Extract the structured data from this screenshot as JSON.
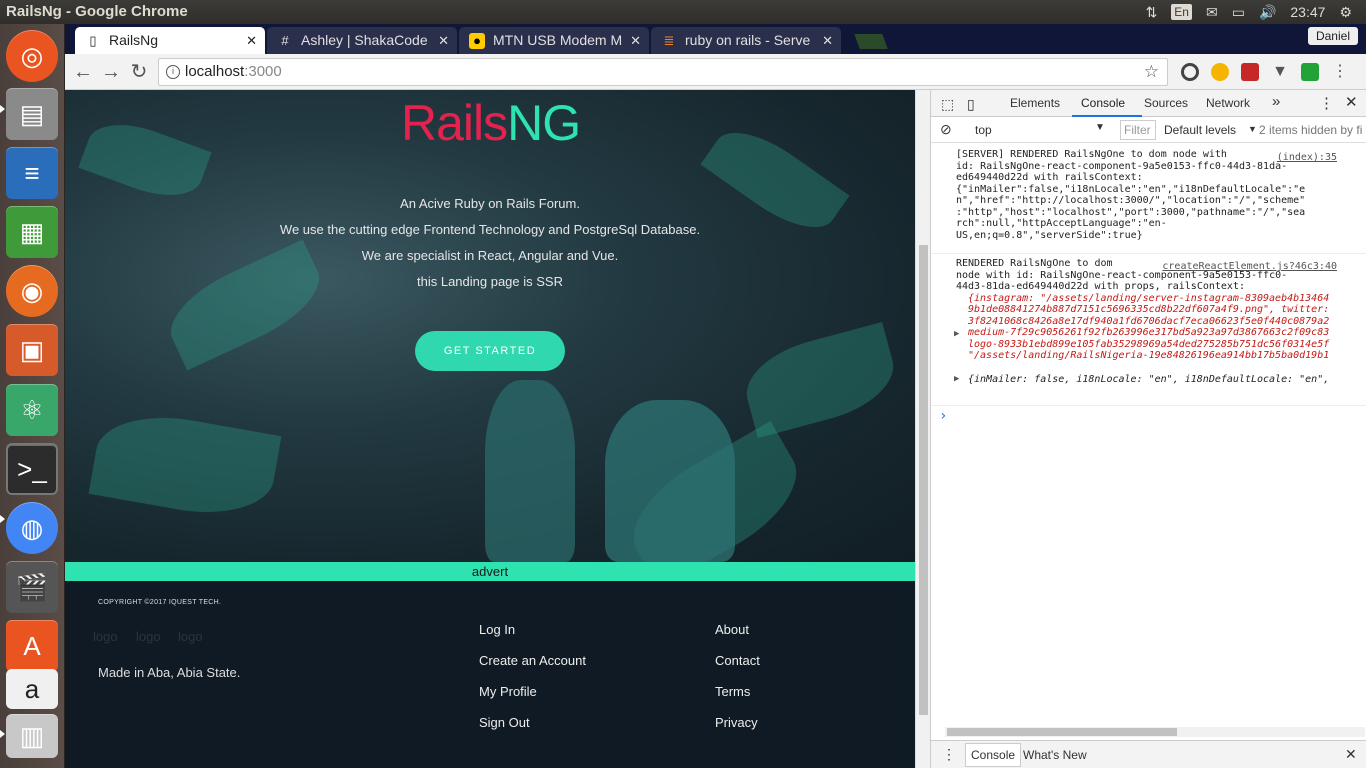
{
  "os": {
    "window_title": "RailsNg - Google Chrome",
    "keyboard_lang": "En",
    "clock": "23:47",
    "tray_icons": [
      "network-icon",
      "mail-icon",
      "battery-icon",
      "volume-icon",
      "power-icon"
    ]
  },
  "launcher": {
    "items": [
      "ubuntu-dash-icon",
      "files-icon",
      "writer-icon",
      "calc-icon",
      "firefox-icon",
      "impress-icon",
      "atom-icon",
      "terminal-icon",
      "chrome-icon",
      "video-icon",
      "software-center-icon",
      "amazon-icon",
      "trash-icon"
    ]
  },
  "browser": {
    "tabs": [
      {
        "label": "RailsNg",
        "icon": "page-icon",
        "active": true
      },
      {
        "label": "Ashley | ShakaCode",
        "icon": "hash-icon",
        "active": false
      },
      {
        "label": "MTN USB Modem M",
        "icon": "mtn-icon",
        "active": false
      },
      {
        "label": "ruby on rails - Serve",
        "icon": "stackoverflow-icon",
        "active": false
      }
    ],
    "profile_name": "Daniel",
    "url_host": "localhost",
    "url_port": ":3000"
  },
  "page": {
    "logo_red": "Rails",
    "logo_green": "NG",
    "taglines": [
      "An Acive Ruby on Rails Forum.",
      "We use the cutting edge Frontend Technology and PostgreSql Database.",
      "We are specialist in React, Angular and Vue.",
      "this Landing page is SSR"
    ],
    "cta_label": "GET STARTED",
    "advert_label": "advert",
    "footer": {
      "copyright": "COPYRIGHT ©2017 IQUEST TECH.",
      "logo_placeholders": [
        "logo",
        "logo",
        "logo"
      ],
      "made_in": "Made in Aba, Abia State.",
      "links_col1": [
        "Log In",
        "Create an Account",
        "My Profile",
        "Sign Out"
      ],
      "links_col2": [
        "About",
        "Contact",
        "Terms",
        "Privacy"
      ]
    }
  },
  "devtools": {
    "tabs": [
      "Elements",
      "Console",
      "Sources",
      "Network"
    ],
    "active_tab": "Console",
    "more_tabs": "»",
    "context": "top",
    "filter_placeholder": "Filter",
    "levels": "Default levels",
    "hidden_note": "2 items hidden by fi",
    "messages": [
      {
        "source": "(index):35",
        "lines": [
          "[SERVER] RENDERED RailsNgOne to dom node with",
          "id: RailsNgOne-react-component-9a5e0153-ffc0-44d3-81da-",
          "ed649440d22d with railsContext:",
          "{\"inMailer\":false,\"i18nLocale\":\"en\",\"i18nDefaultLocale\":\"e",
          "n\",\"href\":\"http://localhost:3000/\",\"location\":\"/\",\"scheme\"",
          ":\"http\",\"host\":\"localhost\",\"port\":3000,\"pathname\":\"/\",\"sea",
          "rch\":null,\"httpAcceptLanguage\":\"en-",
          "US,en;q=0.8\",\"serverSide\":true}"
        ]
      },
      {
        "source": "createReactElement.js?46c3:40",
        "lines": [
          "RENDERED RailsNgOne to dom",
          "node with id: RailsNgOne-react-component-9a5e0153-ffc0-",
          "44d3-81da-ed649440d22d with props, railsContext:"
        ],
        "obj_lines": [
          "{instagram: \"/assets/landing/server-instagram-8309aeb4b13464",
          "9b1de08841274b887d7151c5696335cd8b22df607a4f9.png\", twitter:",
          "3f8241068c8426a8e17df940a1fd6706dacf7eca06623f5e0f440c0879a2",
          "medium-7f29c9056261f92fb263996e317bd5a923a97d3867663c2f09c83",
          "logo-8933b1ebd899e105fab35298969a54ded275285b751dc56f0314e5f",
          "\"/assets/landing/RailsNigeria-19e84826196ea914bb17b5ba0d19b1"
        ],
        "context_line": "{inMailer: false, i18nLocale: \"en\", i18nDefaultLocale: \"en\","
      }
    ],
    "prompt": "›",
    "drawer_tabs": [
      "Console",
      "What's New"
    ]
  }
}
